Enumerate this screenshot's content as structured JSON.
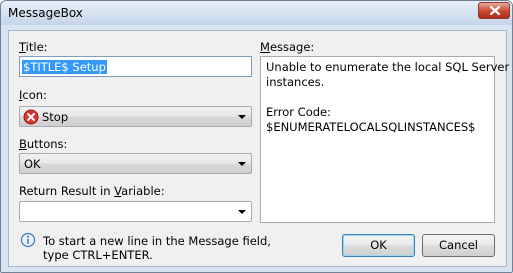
{
  "window": {
    "title": "MessageBox"
  },
  "form": {
    "title_label_u": "T",
    "title_label_rest": "itle:",
    "title_value": "$TITLE$ Setup",
    "icon_label_u": "I",
    "icon_label_rest": "con:",
    "icon_value": "Stop",
    "buttons_label_u": "B",
    "buttons_label_rest": "uttons:",
    "buttons_value": "OK",
    "return_label_pre": "Return Result in ",
    "return_label_u": "V",
    "return_label_rest": "ariable:",
    "return_value": ""
  },
  "message": {
    "label_u": "M",
    "label_rest": "essage:",
    "lines": [
      "Unable to enumerate the local SQL Server",
      "instances.",
      "",
      "Error Code:",
      "$ENUMERATELOCALSQLINSTANCES$"
    ]
  },
  "hint": {
    "line1": "To start a new line in the Message field,",
    "line2": "type CTRL+ENTER."
  },
  "actions": {
    "ok_label": "OK",
    "cancel_label": "Cancel"
  },
  "colors": {
    "selection": "#3399ff",
    "stop_icon": "#d9342b",
    "info_icon": "#3a78c2"
  }
}
